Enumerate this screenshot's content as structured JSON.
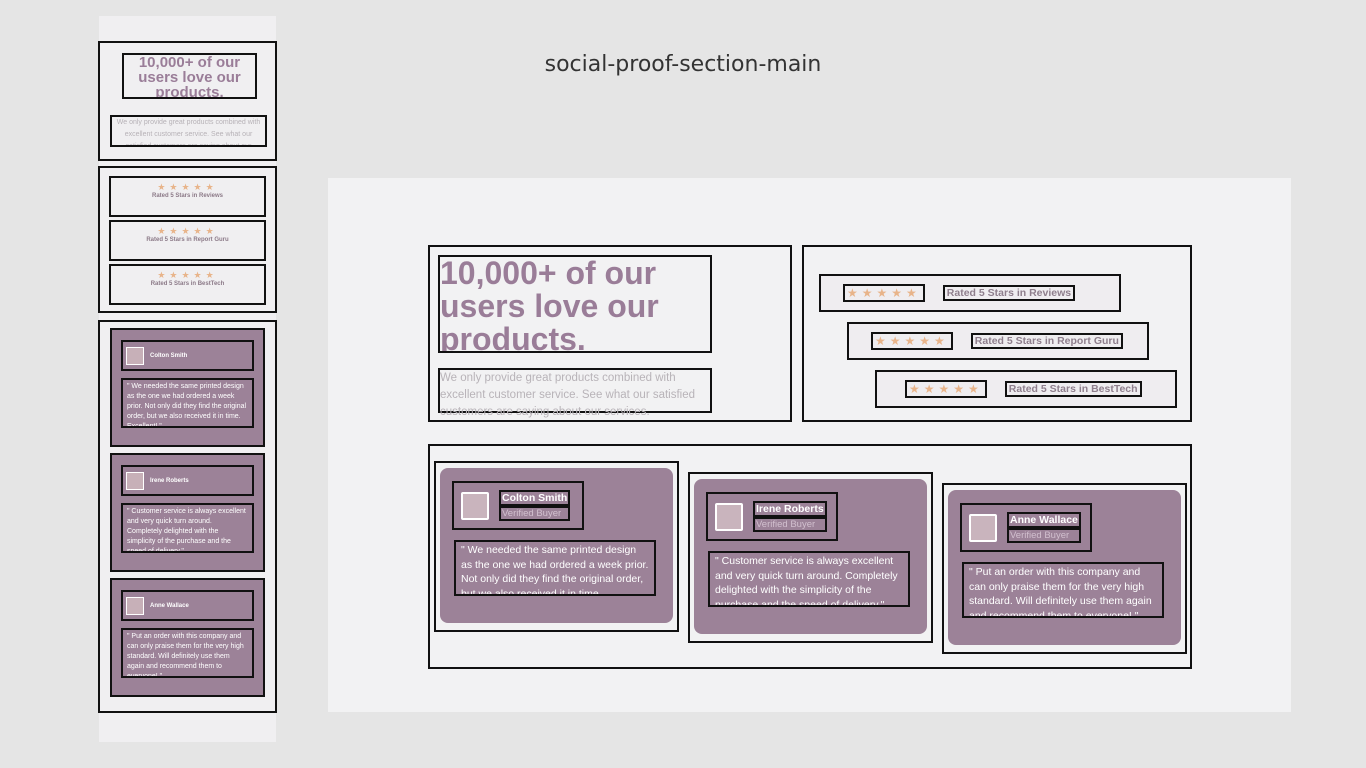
{
  "page_title": "social-proof-section-main",
  "heading": "10,000+ of our users love our products.",
  "intro": "We only provide great products combined with excellent customer service. See what our satisfied customers are saying about our services.",
  "stars": "★★★★★",
  "ratings": [
    {
      "text": "Rated 5 Stars in Reviews"
    },
    {
      "text": "Rated 5 Stars in Report Guru"
    },
    {
      "text": "Rated 5 Stars in BestTech"
    }
  ],
  "testimonials": [
    {
      "name": "Colton Smith",
      "role": "Verified Buyer",
      "quote": "\" We needed the same printed design as the one we had ordered a week prior. Not only did they find the original order, but we also received it in time. Excellent! \""
    },
    {
      "name": "Irene Roberts",
      "role": "Verified Buyer",
      "quote": "\" Customer service is always excellent and very quick turn around. Completely delighted with the simplicity of the purchase and the speed of delivery.\""
    },
    {
      "name": "Anne Wallace",
      "role": "Verified Buyer",
      "quote": "\" Put an order with this company and can only praise them for the very high standard. Will definitely use them again and recommend them to everyone! \""
    }
  ],
  "colors": {
    "accent": "#9c8298",
    "star": "#e8b48a",
    "background": "#e5e5e5"
  }
}
